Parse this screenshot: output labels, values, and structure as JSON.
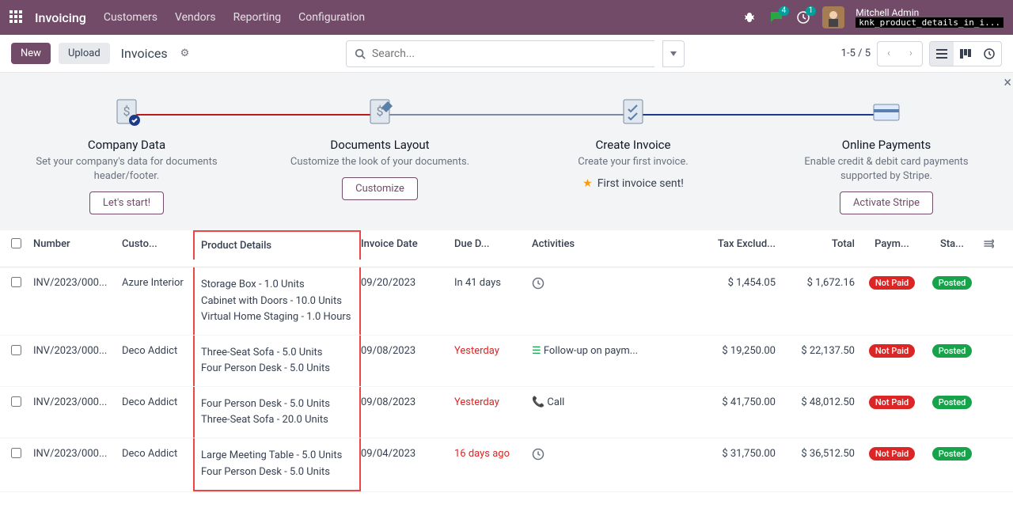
{
  "topbar": {
    "brand": "Invoicing",
    "nav": [
      "Customers",
      "Vendors",
      "Reporting",
      "Configuration"
    ],
    "chat_badge": "4",
    "activity_badge": "1",
    "user": "Mitchell Admin",
    "db": "knk_product_details_in_i..."
  },
  "toolbar": {
    "new": "New",
    "upload": "Upload",
    "crumb": "Invoices",
    "search_placeholder": "Search...",
    "pager": "1-5 / 5"
  },
  "onboard": {
    "close": "×",
    "steps": [
      {
        "title": "Company Data",
        "desc": "Set your company's data for documents header/footer.",
        "action": "Let's start!",
        "type": "button"
      },
      {
        "title": "Documents Layout",
        "desc": "Customize the look of your documents.",
        "action": "Customize",
        "type": "button"
      },
      {
        "title": "Create Invoice",
        "desc": "Create your first invoice.",
        "action": "First invoice sent!",
        "type": "sent"
      },
      {
        "title": "Online Payments",
        "desc": "Enable credit & debit card payments supported by Stripe.",
        "action": "Activate Stripe",
        "type": "button"
      }
    ]
  },
  "columns": {
    "number": "Number",
    "customer": "Custo...",
    "product": "Product Details",
    "invoice_date": "Invoice Date",
    "due": "Due D...",
    "activities": "Activities",
    "tax": "Tax Exclud...",
    "total": "Total",
    "payment": "Paym...",
    "status": "Sta..."
  },
  "rows": [
    {
      "number": "INV/2023/000...",
      "customer": "Azure Interior",
      "products": [
        "Storage Box - 1.0 Units",
        "Cabinet with Doors - 10.0 Units",
        "Virtual Home Staging - 1.0 Hours"
      ],
      "invoice_date": "09/20/2023",
      "due": "In 41 days",
      "due_red": false,
      "activity": "clock",
      "activity_text": "",
      "tax": "$ 1,454.05",
      "total": "$ 1,672.16",
      "payment": "Not Paid",
      "status": "Posted"
    },
    {
      "number": "INV/2023/000...",
      "customer": "Deco Addict",
      "products": [
        "Three-Seat Sofa - 5.0 Units",
        "Four Person Desk - 5.0 Units"
      ],
      "invoice_date": "09/08/2023",
      "due": "Yesterday",
      "due_red": true,
      "activity": "green",
      "activity_text": "Follow-up on paym...",
      "tax": "$ 19,250.00",
      "total": "$ 22,137.50",
      "payment": "Not Paid",
      "status": "Posted"
    },
    {
      "number": "INV/2023/000...",
      "customer": "Deco Addict",
      "products": [
        "Four Person Desk - 5.0 Units",
        "Three-Seat Sofa - 20.0 Units"
      ],
      "invoice_date": "09/08/2023",
      "due": "Yesterday",
      "due_red": true,
      "activity": "red",
      "activity_text": "Call",
      "tax": "$ 41,750.00",
      "total": "$ 48,012.50",
      "payment": "Not Paid",
      "status": "Posted"
    },
    {
      "number": "INV/2023/000...",
      "customer": "Deco Addict",
      "products": [
        "Large Meeting Table - 5.0 Units",
        "Four Person Desk - 5.0 Units"
      ],
      "invoice_date": "09/04/2023",
      "due": "16 days ago",
      "due_red": true,
      "activity": "clock",
      "activity_text": "",
      "tax": "$ 31,750.00",
      "total": "$ 36,512.50",
      "payment": "Not Paid",
      "status": "Posted"
    }
  ]
}
